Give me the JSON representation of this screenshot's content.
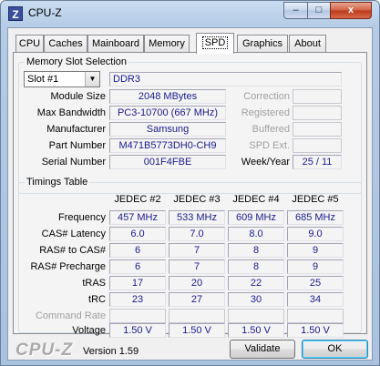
{
  "window": {
    "title": "CPU-Z",
    "app_icon_letter": "Z",
    "controls": {
      "minimize": "–",
      "maximize": "□",
      "close": "x"
    }
  },
  "tabs": [
    {
      "label": "CPU",
      "active": false
    },
    {
      "label": "Caches",
      "active": false
    },
    {
      "label": "Mainboard",
      "active": false
    },
    {
      "label": "Memory",
      "active": false
    },
    {
      "label": "SPD",
      "active": true
    },
    {
      "label": "Graphics",
      "active": false
    },
    {
      "label": "About",
      "active": false
    }
  ],
  "memory_slot": {
    "group_title": "Memory Slot Selection",
    "slot_selected": "Slot #1",
    "memory_type": "DDR3",
    "rows": [
      {
        "label": "Module Size",
        "value": "2048 MBytes"
      },
      {
        "label": "Max Bandwidth",
        "value": "PC3-10700 (667 MHz)"
      },
      {
        "label": "Manufacturer",
        "value": "Samsung"
      },
      {
        "label": "Part Number",
        "value": "M471B5773DH0-CH9"
      },
      {
        "label": "Serial Number",
        "value": "001F4FBE"
      }
    ],
    "right": [
      {
        "label": "Correction",
        "value": ""
      },
      {
        "label": "Registered",
        "value": ""
      },
      {
        "label": "Buffered",
        "value": ""
      },
      {
        "label": "SPD Ext.",
        "value": ""
      }
    ],
    "week_year_label": "Week/Year",
    "week_year_value": "25 / 11"
  },
  "timings": {
    "group_title": "Timings Table",
    "columns": [
      "JEDEC #2",
      "JEDEC #3",
      "JEDEC #4",
      "JEDEC #5"
    ],
    "rows": [
      {
        "label": "Frequency",
        "values": [
          "457 MHz",
          "533 MHz",
          "609 MHz",
          "685 MHz"
        ]
      },
      {
        "label": "CAS# Latency",
        "values": [
          "6.0",
          "7.0",
          "8.0",
          "9.0"
        ]
      },
      {
        "label": "RAS# to CAS#",
        "values": [
          "6",
          "7",
          "8",
          "9"
        ]
      },
      {
        "label": "RAS# Precharge",
        "values": [
          "6",
          "7",
          "8",
          "9"
        ]
      },
      {
        "label": "tRAS",
        "values": [
          "17",
          "20",
          "22",
          "25"
        ]
      },
      {
        "label": "tRC",
        "values": [
          "23",
          "27",
          "30",
          "34"
        ]
      },
      {
        "label": "Command Rate",
        "values": [
          "",
          "",
          "",
          ""
        ]
      },
      {
        "label": "Voltage",
        "values": [
          "1.50 V",
          "1.50 V",
          "1.50 V",
          "1.50 V"
        ]
      }
    ]
  },
  "footer": {
    "logo": "CPU-Z",
    "version": "Version 1.59",
    "validate_label": "Validate",
    "ok_label": "OK"
  }
}
